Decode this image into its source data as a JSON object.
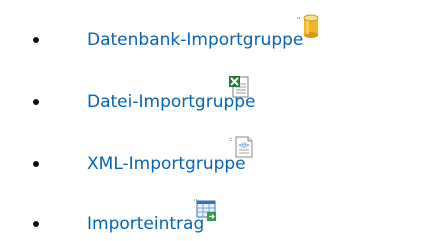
{
  "items": [
    {
      "label": "Datenbank-Importgruppe",
      "icon": "database-icon"
    },
    {
      "label": "Datei-Importgruppe",
      "icon": "excel-file-icon"
    },
    {
      "label": "XML-Importgruppe",
      "icon": "xml-document-icon"
    },
    {
      "label": "Importeintrag",
      "icon": "import-entry-icon"
    }
  ],
  "colors": {
    "link": "#0563b8",
    "bullet": "#111111",
    "database": "#f3b820",
    "excel": "#1f7a3a"
  }
}
